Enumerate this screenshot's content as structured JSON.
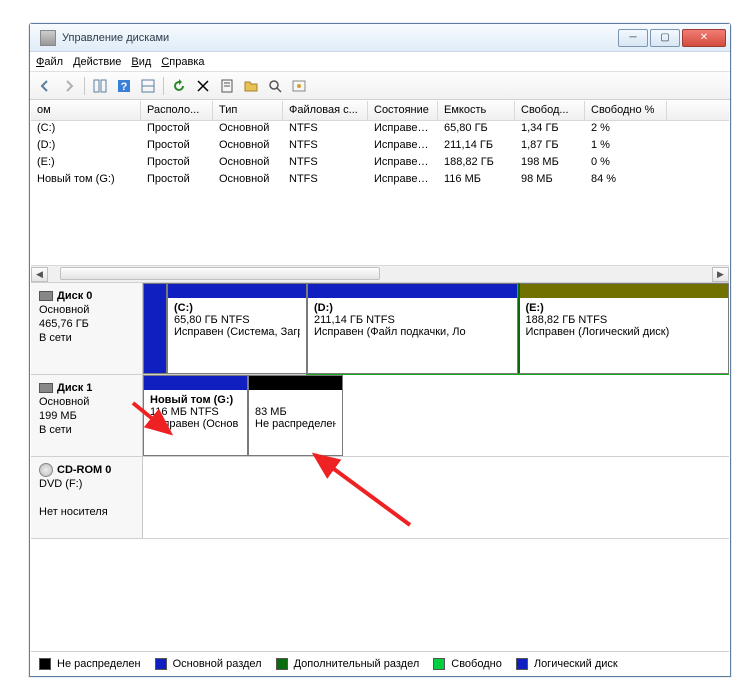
{
  "window": {
    "title": "Управление дисками"
  },
  "menu": {
    "file": "Файл",
    "action": "Действие",
    "view": "Вид",
    "help": "Справка"
  },
  "columns": [
    "ом",
    "Располо...",
    "Тип",
    "Файловая с...",
    "Состояние",
    "Емкость",
    "Свобод...",
    "Свободно %"
  ],
  "volumes": [
    {
      "name": "(C:)",
      "layout": "Простой",
      "type": "Основной",
      "fs": "NTFS",
      "status": "Исправен...",
      "cap": "65,80 ГБ",
      "free": "1,34 ГБ",
      "pct": "2 %"
    },
    {
      "name": "(D:)",
      "layout": "Простой",
      "type": "Основной",
      "fs": "NTFS",
      "status": "Исправен...",
      "cap": "211,14 ГБ",
      "free": "1,87 ГБ",
      "pct": "1 %"
    },
    {
      "name": "(E:)",
      "layout": "Простой",
      "type": "Основной",
      "fs": "NTFS",
      "status": "Исправен...",
      "cap": "188,82 ГБ",
      "free": "198 МБ",
      "pct": "0 %"
    },
    {
      "name": "Новый том (G:)",
      "layout": "Простой",
      "type": "Основной",
      "fs": "NTFS",
      "status": "Исправен...",
      "cap": "116 МБ",
      "free": "98 МБ",
      "pct": "84 %"
    }
  ],
  "disk0": {
    "name": "Диск 0",
    "type": "Основной",
    "size": "465,76 ГБ",
    "status": "В сети",
    "c": {
      "name": "(C:)",
      "info": "65,80 ГБ NTFS",
      "status": "Исправен (Система, Загрузк"
    },
    "d": {
      "name": "(D:)",
      "info": "211,14 ГБ NTFS",
      "status": "Исправен (Файл подкачки, Ло"
    },
    "e": {
      "name": "(E:)",
      "info": "188,82 ГБ NTFS",
      "status": "Исправен (Логический диск)"
    }
  },
  "disk1": {
    "name": "Диск 1",
    "type": "Основной",
    "size": "199 МБ",
    "status": "В сети",
    "g": {
      "name": "Новый том  (G:)",
      "info": "116 МБ NTFS",
      "status": "Исправен (Основ"
    },
    "un": {
      "info": "83 МБ",
      "status": "Не распределен"
    }
  },
  "cdrom": {
    "name": "CD-ROM 0",
    "type": "DVD (F:)",
    "status": "Нет носителя"
  },
  "legend": {
    "unalloc": "Не распределен",
    "primary": "Основной раздел",
    "extended": "Дополнительный раздел",
    "free": "Свободно",
    "logical": "Логический диск"
  }
}
